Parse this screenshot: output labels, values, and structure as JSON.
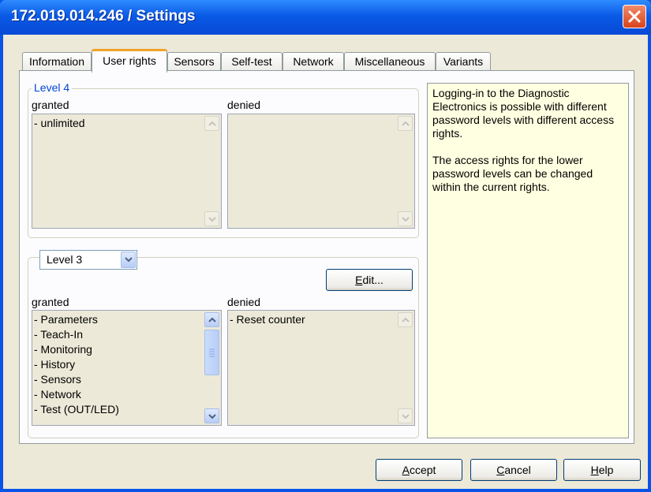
{
  "window": {
    "title": "172.019.014.246 / Settings"
  },
  "tabs": [
    {
      "label": "Information"
    },
    {
      "label": "User rights"
    },
    {
      "label": "Sensors"
    },
    {
      "label": "Self-test"
    },
    {
      "label": "Network"
    },
    {
      "label": "Miscellaneous"
    },
    {
      "label": "Variants"
    }
  ],
  "level_top": {
    "legend": "Level 4",
    "granted_label": "granted",
    "denied_label": "denied",
    "granted_items": [
      "- unlimited"
    ],
    "denied_items": []
  },
  "level_bottom": {
    "selected_level": "Level 3",
    "edit_button": {
      "pre": "",
      "accel": "E",
      "post": "dit..."
    },
    "granted_label": "granted",
    "denied_label": "denied",
    "granted_items": [
      "- Parameters",
      "- Teach-In",
      "- Monitoring",
      "- History",
      "- Sensors",
      "- Network",
      "- Test (OUT/LED)"
    ],
    "denied_items": [
      "- Reset counter"
    ]
  },
  "info": {
    "paragraph1": "Logging-in to the Diagnostic Electronics is possible with different password levels with different access rights.",
    "paragraph2": "The access rights for the lower password levels can be changed within the current rights."
  },
  "buttons": {
    "accept": {
      "accel": "A",
      "rest": "ccept"
    },
    "cancel": {
      "accel": "C",
      "rest": "ancel"
    },
    "help": {
      "accel": "H",
      "rest": "elp"
    }
  },
  "colors": {
    "titlebar": "#0a5ae6",
    "legend": "#0046d5",
    "info_bg": "#ffffe1",
    "active_tab_accent": "#f2a22a"
  }
}
